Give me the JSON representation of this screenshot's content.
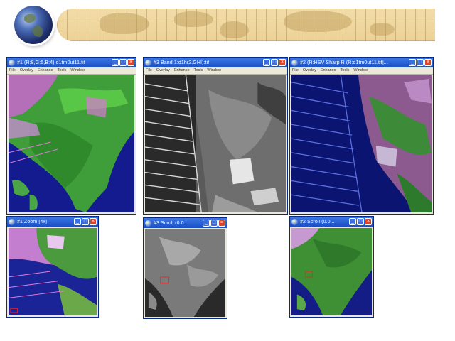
{
  "windows": [
    {
      "title": "#1 (R:8,G:5,B:4):d1tm0ut11.tif",
      "menu": [
        "File",
        "Overlay",
        "Enhance",
        "Tools",
        "Window"
      ]
    },
    {
      "title": "#3 Band 1:d1hr2.GHI):tif",
      "menu": [
        "File",
        "Overlay",
        "Enhance",
        "Tools",
        "Window"
      ]
    },
    {
      "title": "#2 (R:HSV Sharp R (R:d1tm0ut11.tif]...",
      "menu": [
        "File",
        "Overlay",
        "Enhance",
        "Tools",
        "Window"
      ]
    },
    {
      "title": "#1 Zoom [4x]"
    },
    {
      "title": "#3 Scroll (0.0..."
    },
    {
      "title": "#2 Scroll (0.0..."
    }
  ],
  "icons": {
    "minimize": "minimize-icon",
    "maximize": "maximize-icon",
    "close": "close-icon"
  },
  "colors": {
    "titlebar": "#1b4fc4",
    "close_button": "#d9472b",
    "window_face": "#e9e7df",
    "banner": "#ecd296"
  }
}
